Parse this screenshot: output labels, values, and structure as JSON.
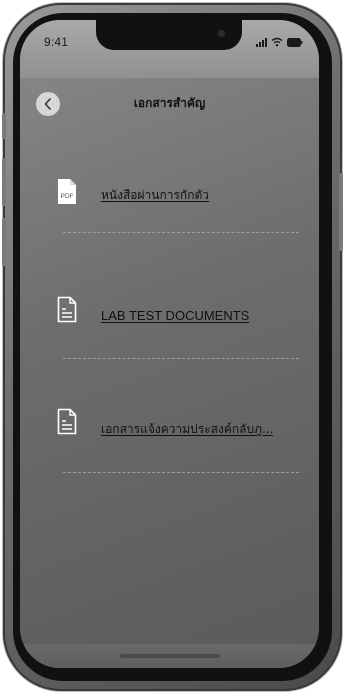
{
  "status_bar": {
    "time": "9:41"
  },
  "header": {
    "title": "เอกสารสำคัญ",
    "back_icon": "chevron-left-icon"
  },
  "documents": [
    {
      "label": "หนังสือผ่านการกักตัว",
      "icon": "pdf-file-icon",
      "icon_text": "PDF"
    },
    {
      "label": "LAB TEST DOCUMENTS",
      "icon": "document-icon"
    },
    {
      "label": "เอกสารแจ้งความประสงค์กลับภู...",
      "icon": "document-icon"
    }
  ],
  "colors": {
    "screen_bg": "#6c6c6c",
    "status_bar_bg": "#9c9c9c",
    "text": "#111111",
    "back_button_bg": "#d7d7d7"
  }
}
